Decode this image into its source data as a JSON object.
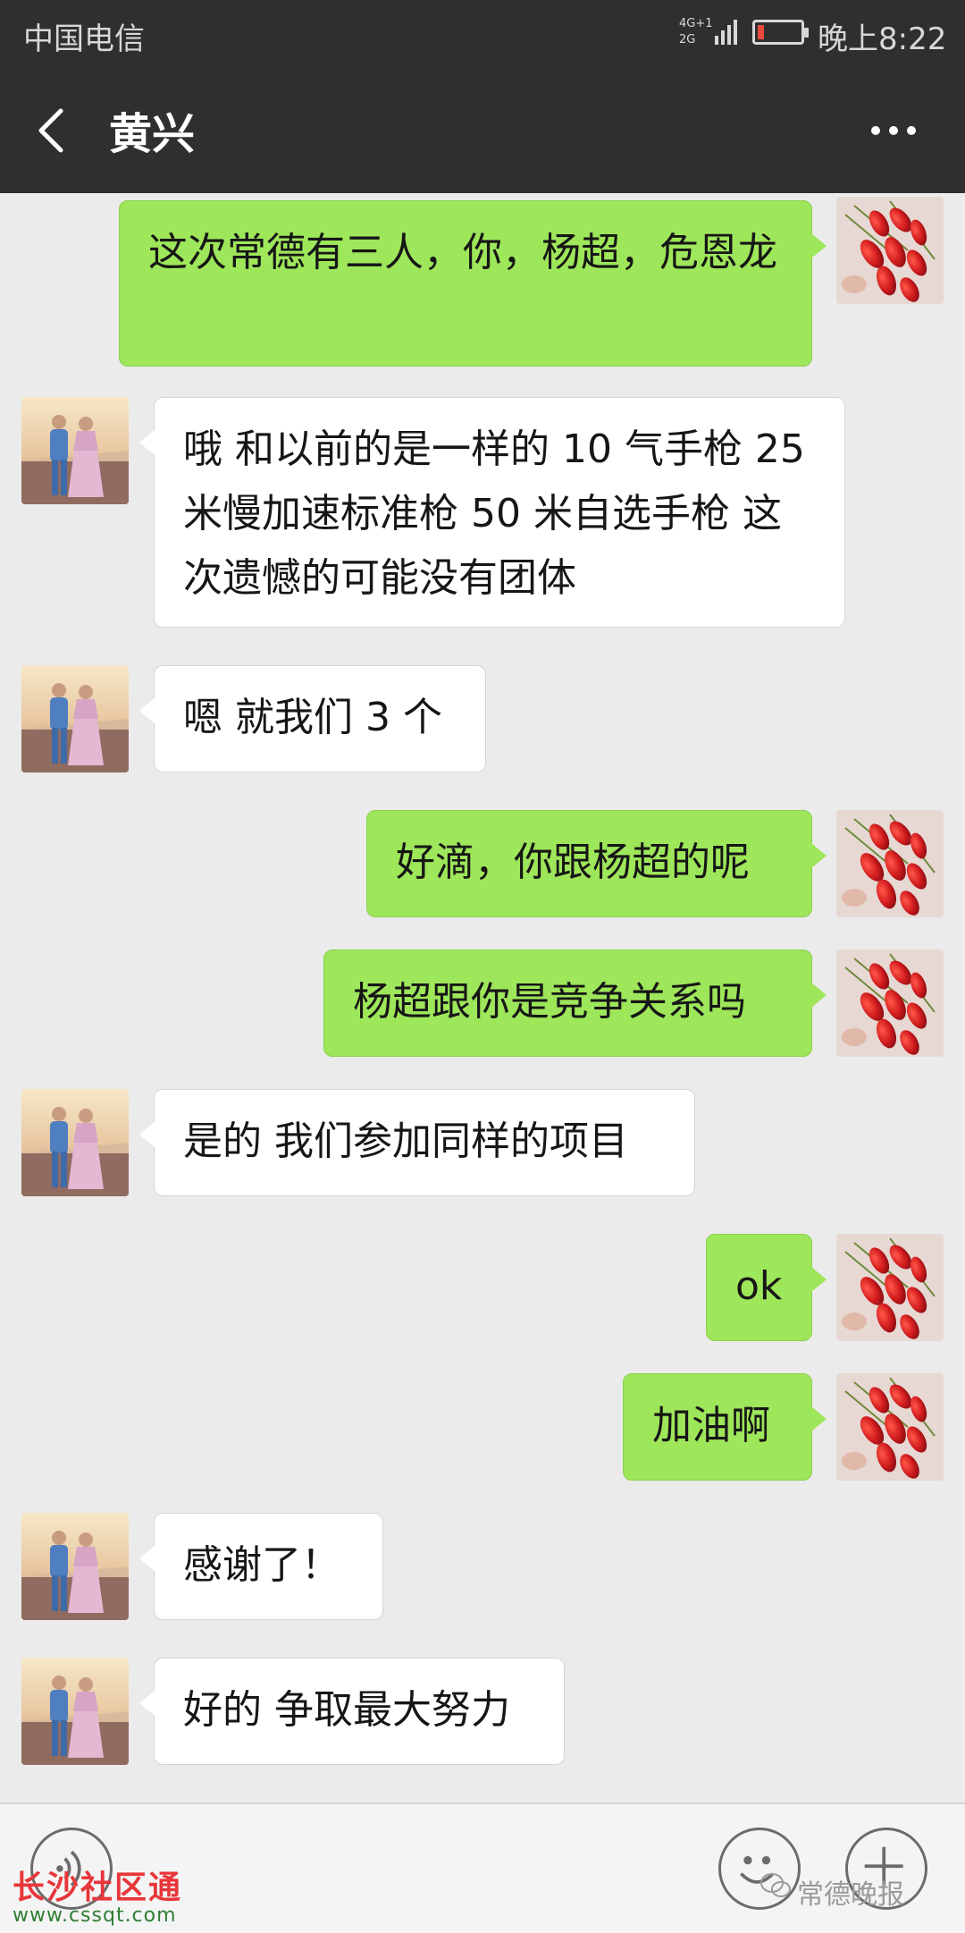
{
  "status_bar": {
    "carrier": "中国电信",
    "network": "4G 2G",
    "time": "晚上8:22"
  },
  "header": {
    "contact_name": "黄兴"
  },
  "messages": [
    {
      "sender": "self",
      "text": "这次常德有三人，你，杨超，危恩龙"
    },
    {
      "sender": "other",
      "text": "哦 和以前的是一样的 10 气手枪 25 米慢加速标准枪 50 米自选手枪 这次遗憾的可能没有团体"
    },
    {
      "sender": "other",
      "text": "嗯 就我们 3 个"
    },
    {
      "sender": "self",
      "text": "好滴，你跟杨超的呢"
    },
    {
      "sender": "self",
      "text": "杨超跟你是竞争关系吗"
    },
    {
      "sender": "other",
      "text": "是的 我们参加同样的项目"
    },
    {
      "sender": "self",
      "text": "ok"
    },
    {
      "sender": "self",
      "text": "加油啊"
    },
    {
      "sender": "other",
      "text": "感谢了！"
    },
    {
      "sender": "other",
      "text": "好的 争取最大努力"
    }
  ],
  "watermarks": {
    "left_logo_text": "长沙社区通",
    "left_url": "www.cssqt.com",
    "right_text": "常德晚报"
  },
  "colors": {
    "header_bg": "#2f2f2f",
    "chat_bg": "#ebebeb",
    "self_bubble": "#9ee65a",
    "other_bubble": "#ffffff"
  },
  "icons": [
    "back-arrow-icon",
    "more-icon",
    "voice-icon",
    "emoji-icon",
    "plus-icon"
  ]
}
